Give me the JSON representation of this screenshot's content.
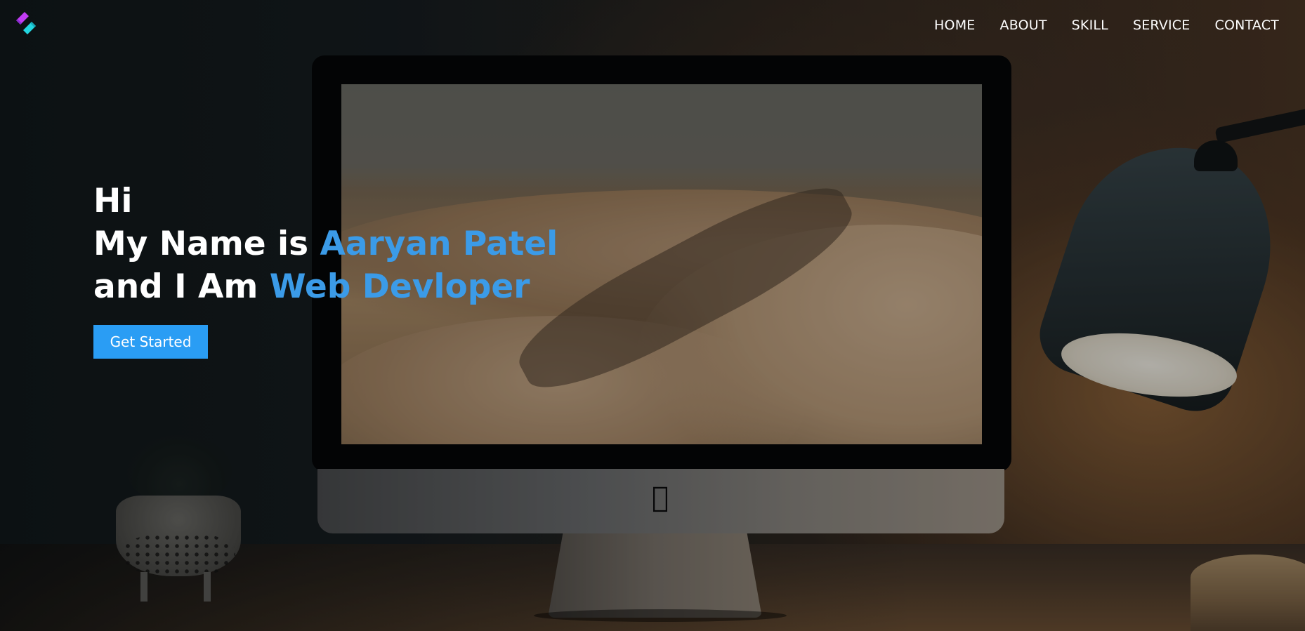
{
  "brand": {
    "logo_icon": "dev-logo-icon",
    "colors": {
      "primary": "#2a9df4",
      "accent_text": "#3b9be8",
      "logo_magenta": "#c13cf2",
      "logo_cyan": "#22d6e0"
    }
  },
  "nav": {
    "items": [
      {
        "label": "HOME"
      },
      {
        "label": "ABOUT"
      },
      {
        "label": "SKILL"
      },
      {
        "label": "SERVICE"
      },
      {
        "label": "CONTACT"
      }
    ]
  },
  "hero": {
    "greeting": "Hi",
    "line2_prefix": "My Name is ",
    "name": "Aaryan Patel",
    "line3_prefix": "and I Am ",
    "role": "Web Devloper",
    "cta_label": "Get Started"
  }
}
